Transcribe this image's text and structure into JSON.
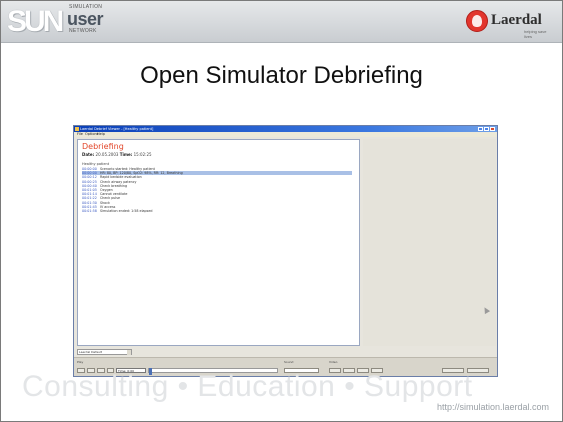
{
  "header": {
    "logo_letters": "SUN",
    "logo_line1": "SIMULATION",
    "logo_user": "user",
    "logo_line2": "NETWORK",
    "brand": "Laerdal",
    "brand_tagline": "helping save lives"
  },
  "slide": {
    "title": "Open Simulator Debriefing"
  },
  "screenshot": {
    "window_title": "Laerdal Debrief Viewer - [Healthy patient]",
    "menu": [
      "File",
      "Options",
      "Help"
    ],
    "heading": "Debriefing",
    "date_label": "Date:",
    "date_value": "20.05.2003 ",
    "time_label": "Time:",
    "time_value": "15:02:25",
    "section": "Healthy patient",
    "log": [
      {
        "time": "00:00:00",
        "text": "Scenario started: Healthy patient"
      },
      {
        "time": "00:00:00",
        "text": "HR: 80, BP: 120/80, SpO2: 98%, RR: 12, Breathing"
      },
      {
        "time": "00:00:12",
        "text": "Rapid bedside evaluation"
      },
      {
        "time": "00:00:25",
        "text": "Check airway patency"
      },
      {
        "time": "00:00:40",
        "text": "Check breathing"
      },
      {
        "time": "00:01:05",
        "text": "Oxygen"
      },
      {
        "time": "00:01:14",
        "text": "Cannot ventilate"
      },
      {
        "time": "00:01:22",
        "text": "Check pulse"
      },
      {
        "time": "00:01:30",
        "text": "Shock"
      },
      {
        "time": "00:01:45",
        "text": "IV access"
      },
      {
        "time": "00:01:58",
        "text": "Simulation ended: 1:58 elapsed"
      }
    ],
    "selector_value": "Laerdal Default",
    "bottom": {
      "play_label": "Play",
      "time_field": "Time: 0:00",
      "sound_label": "Sound",
      "video_label": "Video"
    }
  },
  "footer": {
    "tagline": "Consulting  •  Education  •  Support",
    "url": "http://simulation.laerdal.com"
  }
}
